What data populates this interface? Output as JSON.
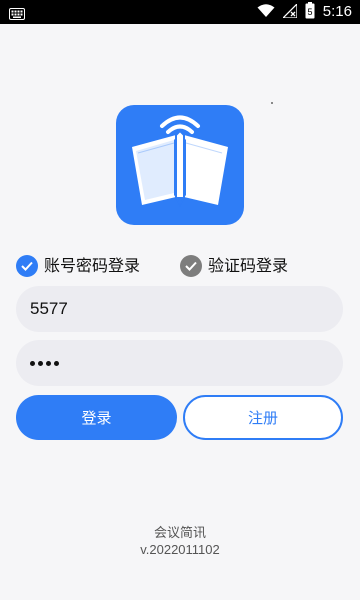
{
  "status_bar": {
    "time": "5:16",
    "battery_level": "5",
    "icons": [
      "keyboard-icon",
      "wifi-icon",
      "signal-icon",
      "battery-icon"
    ]
  },
  "app": {
    "logo_icon": "book-wifi-icon",
    "accent_color": "#2f7df6"
  },
  "login_options": [
    {
      "label": "账号密码登录",
      "selected": true
    },
    {
      "label": "验证码登录",
      "selected": false
    }
  ],
  "form": {
    "username_value": "5577",
    "password_masked": "••••"
  },
  "buttons": {
    "login": "登录",
    "register": "注册"
  },
  "footer": {
    "app_name": "会议简讯",
    "version": "v.2022011102"
  }
}
